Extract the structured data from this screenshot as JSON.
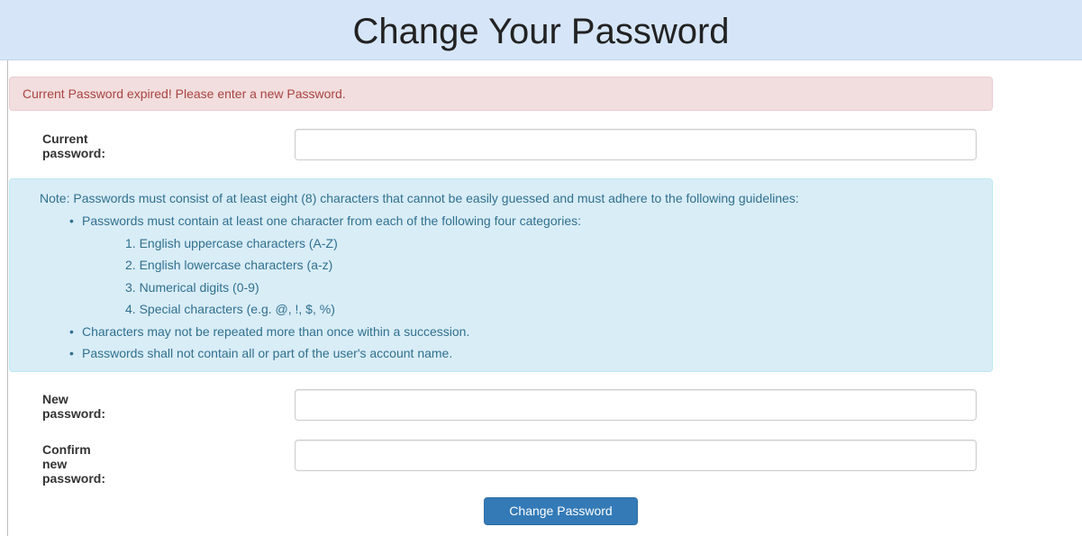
{
  "header": {
    "title": "Change Your Password"
  },
  "alert": {
    "message": "Current Password expired! Please enter a new Password."
  },
  "fields": {
    "current": {
      "label_line1": "Current",
      "label_line2": "password:",
      "value": ""
    },
    "new": {
      "label_line1": "New",
      "label_line2": "password:",
      "value": ""
    },
    "confirm": {
      "label_line1": "Confirm",
      "label_line2": "new",
      "label_line3": "password:",
      "value": ""
    }
  },
  "note": {
    "intro": "Note: Passwords must consist of at least eight (8) characters that cannot be easily guessed and must adhere to the following guidelines:",
    "bullets": [
      "Passwords must contain at least one character from each of the following four categories:",
      "Characters may not be repeated more than once within a succession.",
      "Passwords shall not contain all or part of the user's account name."
    ],
    "categories": [
      "1. English uppercase characters (A-Z)",
      "2. English lowercase characters (a-z)",
      "3. Numerical digits (0-9)",
      "4. Special characters (e.g. @, !, $, %)"
    ]
  },
  "submit": {
    "label": "Change Password"
  },
  "colors": {
    "header_bg": "#d6e6f8",
    "danger_bg": "#f2dede",
    "danger_text": "#a94442",
    "info_bg": "#d9edf7",
    "info_text": "#31708f",
    "primary": "#337ab7"
  }
}
